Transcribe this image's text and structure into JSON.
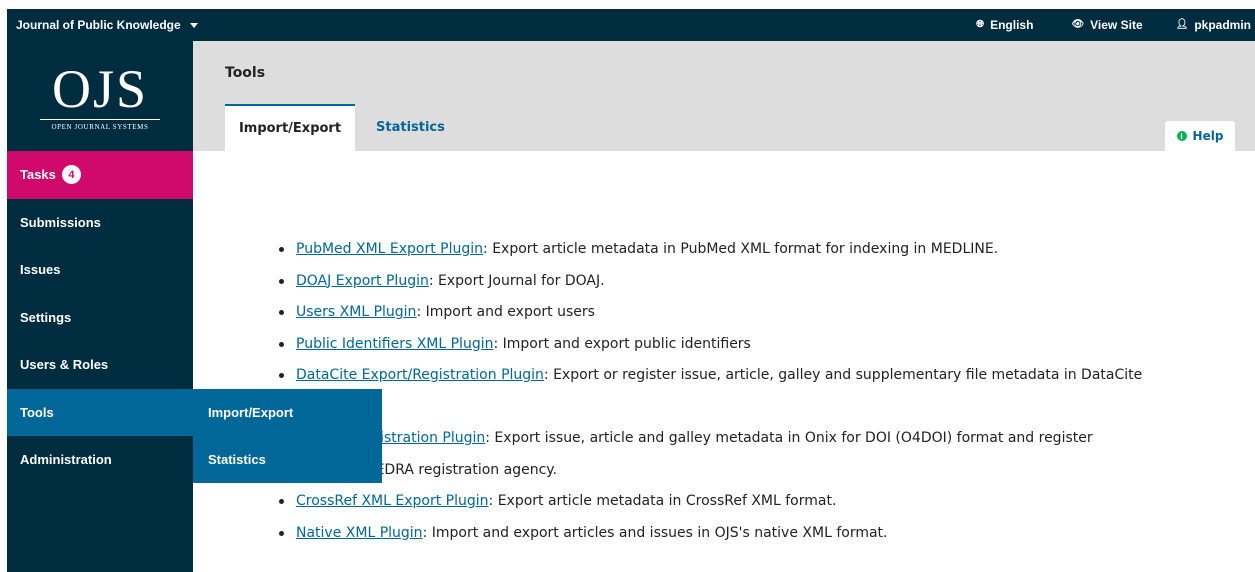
{
  "topbar": {
    "journal": "Journal of Public Knowledge",
    "language": "English",
    "view_site": "View Site",
    "user": "pkpadmin"
  },
  "logo": {
    "big": "OJS",
    "small": "OPEN JOURNAL SYSTEMS"
  },
  "sidebar": {
    "items": [
      {
        "label": "Tasks",
        "badge": "4"
      },
      {
        "label": "Submissions"
      },
      {
        "label": "Issues"
      },
      {
        "label": "Settings"
      },
      {
        "label": "Users & Roles"
      },
      {
        "label": "Tools"
      },
      {
        "label": "Administration"
      }
    ],
    "submenu": [
      "Import/Export",
      "Statistics"
    ]
  },
  "page": {
    "title": "Tools",
    "tabs": [
      "Import/Export",
      "Statistics"
    ],
    "help": "Help"
  },
  "plugins": [
    {
      "name": "PubMed XML Export Plugin",
      "desc": ": Export article metadata in PubMed XML format for indexing in MEDLINE."
    },
    {
      "name": "DOAJ Export Plugin",
      "desc": ": Export Journal for DOAJ."
    },
    {
      "name": "Users XML Plugin",
      "desc": ": Import and export users"
    },
    {
      "name": "Public Identifiers XML Plugin",
      "desc": ": Import and export public identifiers"
    },
    {
      "name": "DataCite Export/Registration Plugin",
      "desc": ": Export or register issue, article, galley and supplementary file metadata in DataCite"
    },
    {
      "name": "ort/Registration Plugin",
      "desc": ": Export issue, article and galley metadata in Onix for DOI (O4DOI) format and register",
      "cont": "he mEDRA registration agency."
    },
    {
      "name": "CrossRef XML Export Plugin",
      "desc": ": Export article metadata in CrossRef XML format."
    },
    {
      "name": "Native XML Plugin",
      "desc": ": Import and export articles and issues in OJS's native XML format."
    }
  ]
}
